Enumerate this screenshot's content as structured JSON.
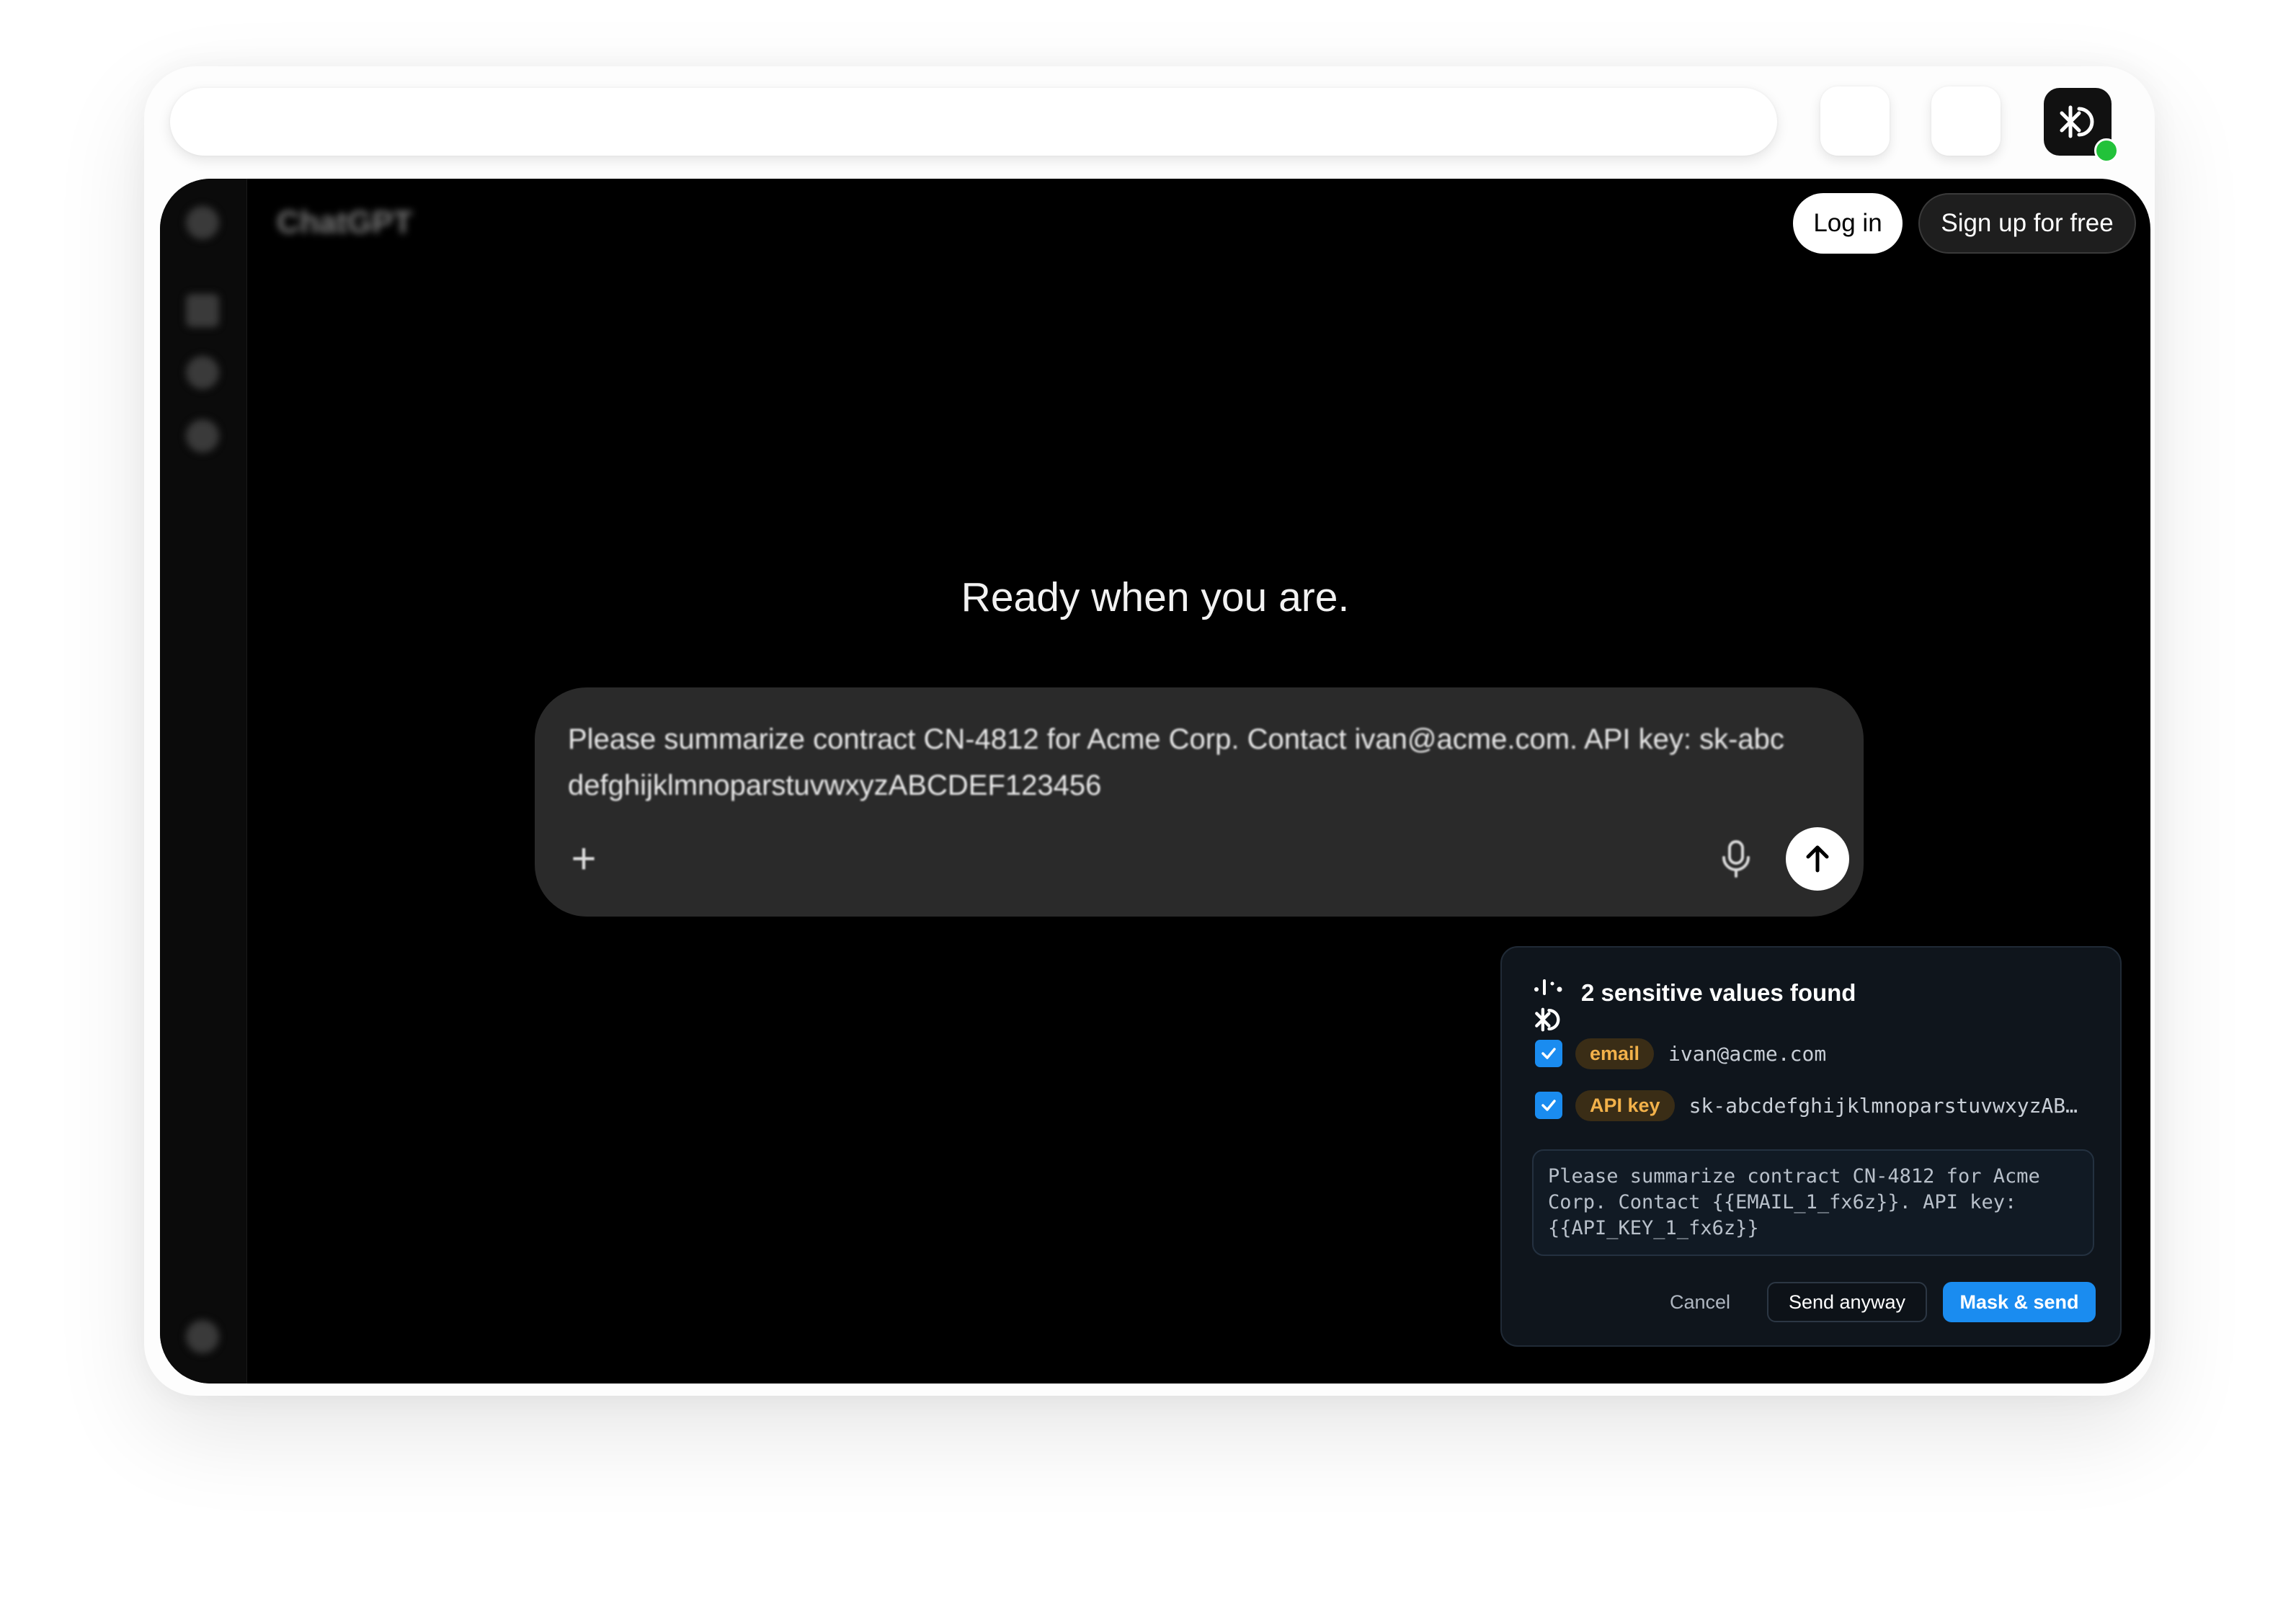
{
  "browser": {
    "extension_active": true
  },
  "site": {
    "brand": "ChatGPT",
    "login_label": "Log in",
    "signup_label": "Sign up for free",
    "hero_text": "Ready when you are.",
    "composer": {
      "text": "Please summarize contract CN-4812 for Acme Corp. Contact ivan@acme.com. API key: sk-abcdefghijklmnoparstuvwxyzABCDEF123456",
      "plus_icon": "plus-icon",
      "mic_icon": "microphone-icon",
      "send_icon": "arrow-up-icon"
    }
  },
  "popup": {
    "title": "2 sensitive values found",
    "findings": [
      {
        "type": "email",
        "value": "ivan@acme.com",
        "checked": true
      },
      {
        "type": "API key",
        "value": "sk-abcdefghijklmnoparstuvwxyzAB…",
        "checked": true
      }
    ],
    "preview": "Please summarize contract CN-4812 for Acme Corp. Contact {{EMAIL_1_fx6z}}. API key: {{API_KEY_1_fx6z}}",
    "cancel_label": "Cancel",
    "send_anyway_label": "Send anyway",
    "mask_send_label": "Mask & send"
  },
  "colors": {
    "accent": "#1a8cf0",
    "badge_bg": "#3a2d16",
    "badge_text": "#f2b14a",
    "status_green": "#22c23a"
  }
}
